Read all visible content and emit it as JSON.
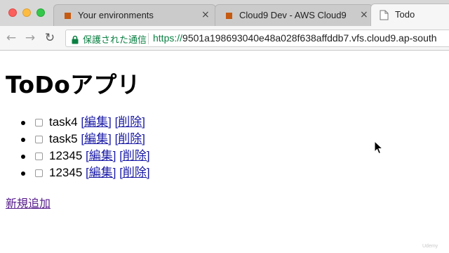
{
  "tabs": [
    {
      "title": "Your environments",
      "icon": "aws-cloud9-icon",
      "close": "×"
    },
    {
      "title": "Cloud9 Dev - AWS Cloud9",
      "icon": "aws-cloud9-icon",
      "close": "×"
    },
    {
      "title": "Todo",
      "icon": "document-icon",
      "active": true
    }
  ],
  "toolbar": {
    "back_icon": "←",
    "forward_icon": "→",
    "reload_icon": "↻",
    "secure_label": "保護された通信",
    "url_scheme": "https://",
    "url_rest": "9501a198693040e48a028f638affddb7.vfs.cloud9.ap-south"
  },
  "page": {
    "title": "ToDoアプリ",
    "todos": [
      {
        "text": "task4",
        "edit": "[編集]",
        "delete": "[削除]"
      },
      {
        "text": "task5",
        "edit": "[編集]",
        "delete": "[削除]"
      },
      {
        "text": "12345",
        "edit": "[編集]",
        "delete": "[削除]"
      },
      {
        "text": "12345",
        "edit": "[編集]",
        "delete": "[削除]"
      }
    ],
    "add_link": "新規追加"
  },
  "watermark": "Udemy",
  "colors": {
    "secure_green": "#0b8043",
    "link_blue": "#1a1aa6",
    "visited_purple": "#551a8b",
    "tab_bar": "#d7d7d7",
    "aws_orange": "#f2902f"
  }
}
